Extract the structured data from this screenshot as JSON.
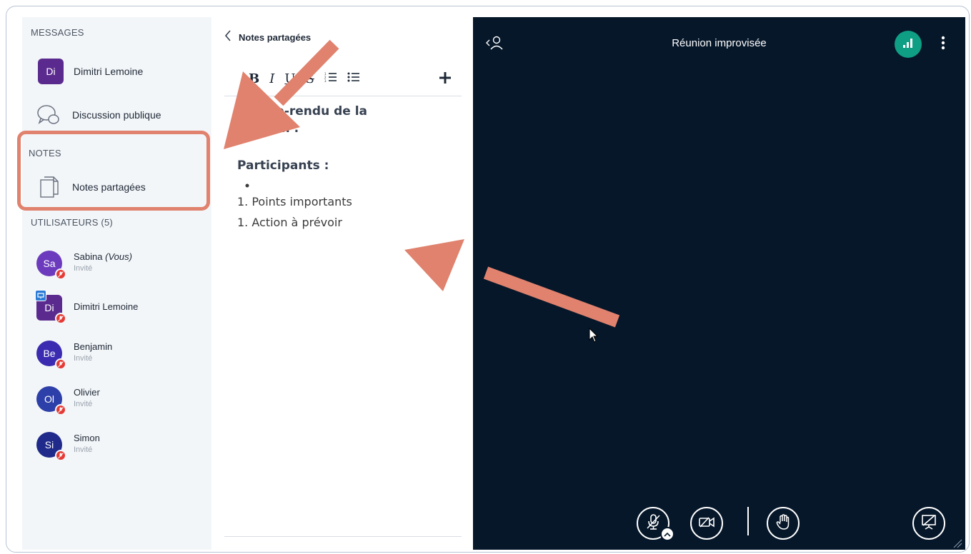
{
  "sidebar": {
    "messages_title": "MESSAGES",
    "messages": [
      {
        "initials": "Di",
        "label": "Dimitri Lemoine"
      },
      {
        "label": "Discussion publique",
        "icon": "chat-bubbles-icon"
      }
    ],
    "notes_title": "NOTES",
    "notes_item": {
      "label": "Notes partagées",
      "icon": "document-icon"
    },
    "users_title": "UTILISATEURS (5)",
    "users": [
      {
        "initials": "Sa",
        "name": "Sabina",
        "suffix": "(Vous)",
        "role": "Invité",
        "color": "#6c3bbd"
      },
      {
        "initials": "Di",
        "name": "Dimitri Lemoine",
        "role": "",
        "color": "#5b2a8e"
      },
      {
        "initials": "Be",
        "name": "Benjamin",
        "role": "Invité",
        "color": "#3b2bb0"
      },
      {
        "initials": "Ol",
        "name": "Olivier",
        "role": "Invité",
        "color": "#2d3fa8"
      },
      {
        "initials": "Si",
        "name": "Simon",
        "role": "Invité",
        "color": "#1f2a8a"
      }
    ]
  },
  "notes_panel": {
    "title": "Notes partagées",
    "toolbar": [
      "B",
      "I",
      "U",
      "S"
    ],
    "content": {
      "heading_line1": "pte-rendu de la",
      "heading_line2": "ion :",
      "participants": "Participants :",
      "list1": "1.  Points importants",
      "list2": "1. Action à prévoir"
    }
  },
  "video": {
    "title": "Réunion improvisée"
  },
  "colors": {
    "accent_green": "#0e9f85",
    "annotation": "#e0826d",
    "video_bg": "#06172a",
    "mic_off": "#e53935"
  }
}
